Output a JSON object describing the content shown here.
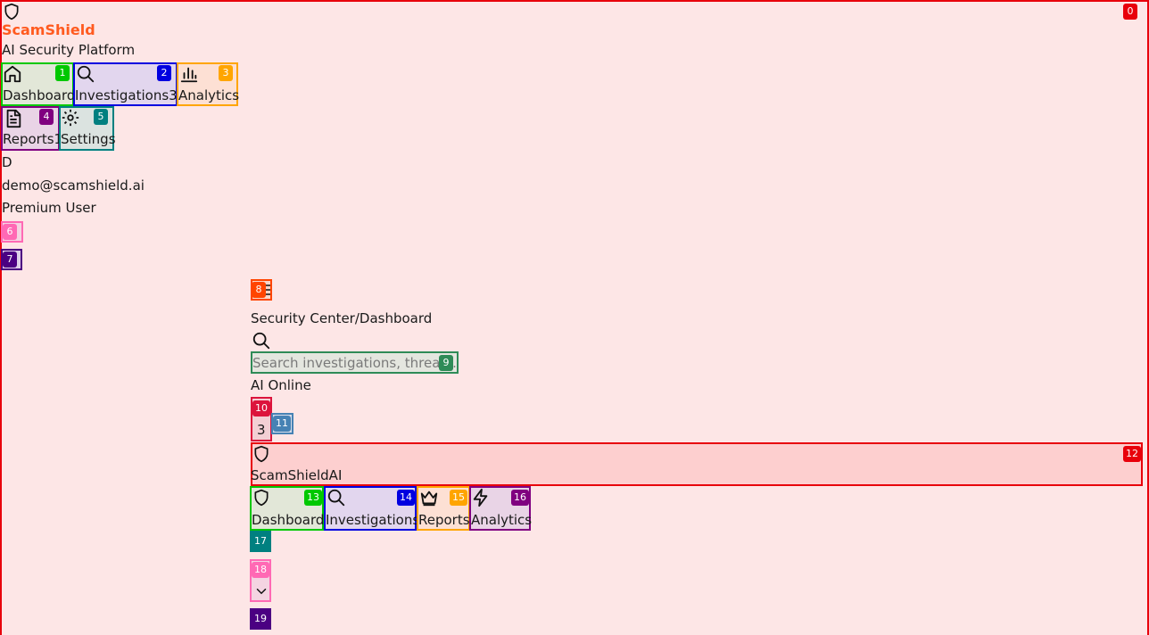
{
  "app": {
    "brand": "ScamShield",
    "tagline": "AI Security Platform",
    "brand_color": "#ff5a1f"
  },
  "sidebar": {
    "nav": [
      {
        "label": "Dashboard",
        "icon": "home-icon"
      },
      {
        "label": "Investigations",
        "icon": "search-icon",
        "count": "3"
      },
      {
        "label": "Analytics",
        "icon": "bar-chart-icon"
      },
      {
        "label": "Reports",
        "icon": "file-text-icon",
        "count": "1"
      },
      {
        "label": "Settings",
        "icon": "gear-icon"
      }
    ],
    "user": {
      "initial": "D",
      "email": "demo@scamshield.ai",
      "plan": "Premium User"
    }
  },
  "header": {
    "breadcrumb": "Security Center/Dashboard",
    "search_placeholder": "Search investigations, threats...",
    "ai_status": "AI Online",
    "notification_count": "3"
  },
  "banner": {
    "title": "ScamShieldAI"
  },
  "subnav": {
    "items": [
      {
        "label": "Dashboard",
        "icon": "shield-icon"
      },
      {
        "label": "Investigations",
        "icon": "search-icon"
      },
      {
        "label": "Reports",
        "icon": "crown-icon"
      },
      {
        "label": "Analytics",
        "icon": "zap-icon"
      }
    ]
  },
  "annotation_colors": {
    "0": "#e8000b",
    "1": "#00c800",
    "2": "#0000e0",
    "3": "#ffa500",
    "4": "#800080",
    "5": "#008080",
    "6": "#ff69b4",
    "7": "#4b0082",
    "8": "#ff4500",
    "9": "#2e8b57",
    "10": "#dc143c",
    "11": "#4682b4",
    "12": "#e8000b",
    "13": "#00c800",
    "14": "#0000e0",
    "15": "#ffa500",
    "16": "#800080",
    "17": "#008080",
    "18": "#ff69b4",
    "19": "#4b0082"
  }
}
